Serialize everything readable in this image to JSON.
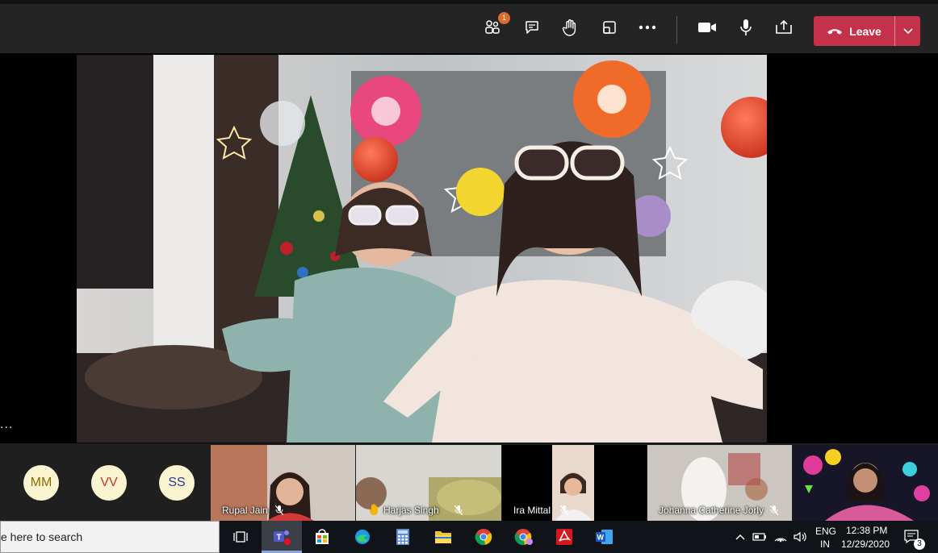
{
  "toolbar": {
    "participants_badge": "1",
    "leave_label": "Leave",
    "icons": [
      "participants-icon",
      "chat-icon",
      "raise-hand-icon",
      "breakout-rooms-icon",
      "more-actions-icon",
      "camera-icon",
      "microphone-icon",
      "share-tray-icon",
      "phone-icon",
      "chevron-down-icon"
    ]
  },
  "main_video": {
    "more_dots": "..."
  },
  "participants": {
    "avatars": [
      {
        "initials": "MM"
      },
      {
        "initials": "VV"
      },
      {
        "initials": "SS"
      }
    ],
    "tiles": [
      {
        "name": "Rupal Jain"
      },
      {
        "name": "Harjas Singh"
      },
      {
        "name": "Ira Mittal"
      },
      {
        "name": "Johanna Catherine Jorly"
      },
      {
        "name": ""
      }
    ]
  },
  "taskbar": {
    "search_text": "e here to search",
    "lang_top": "ENG",
    "lang_bottom": "IN",
    "time": "12:38 PM",
    "date": "12/29/2020",
    "notifications": "3"
  },
  "colors": {
    "leave": "#c4314b",
    "badge": "#e06a2c",
    "toolbar_bg": "#242424",
    "avatar_bg": "#faf4d0"
  }
}
